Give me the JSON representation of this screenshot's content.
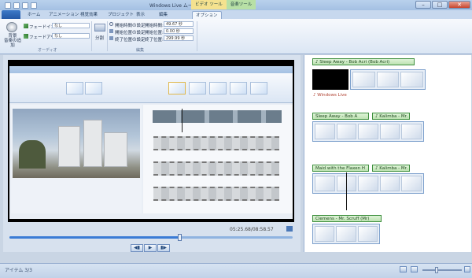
{
  "title": "Windows Live ムービー メーカー",
  "context_groups": [
    {
      "label": "ビデオ ツール",
      "color": "#f5e28f"
    },
    {
      "label": "音楽ツール",
      "color": "#b8e0a6"
    }
  ],
  "tabs": [
    "ホーム",
    "アニメーション",
    "視覚効果",
    "プロジェクト",
    "表示",
    "編集",
    "オプション"
  ],
  "active_tab_index": 6,
  "ribbon": {
    "music_button": "背景\n音楽の追加",
    "fade_in_label": "フェードイン:",
    "fade_in_value": "なし",
    "fade_out_label": "フェードアウト:",
    "fade_out_value": "なし",
    "split_label": "分割",
    "set_start_time": "開始時間の設定",
    "set_start_point": "開始位置の設定",
    "set_end_point": "終了位置の設定",
    "start_time_label": "開始時間:",
    "start_time_value": "49.67 秒",
    "start_point_label": "開始位置:",
    "start_point_value": "0.00 秒",
    "end_point_label": "終了位置:",
    "end_point_value": "299.99 秒",
    "group_audio": "オーディオ",
    "group_edit": "編集"
  },
  "preview": {
    "timecode": "05:25.68/08:58.57"
  },
  "storyboard": {
    "items": [
      {
        "caption": "♪ Sleep Away - Bob Acri (Bob Acri)",
        "dark_first": true,
        "red_caption": "♪ Windows Live"
      },
      {
        "caption": "Sleep Away - Bob A",
        "caption2": "♪ Kalimba - Mr. S"
      },
      {
        "caption": "Maid with the Flaxen H",
        "caption2": "♪ Kalimba - Mr."
      },
      {
        "caption": "Clemens - Mr. Scruff (Mr)"
      }
    ]
  },
  "status": {
    "text": "アイテム 3/3"
  }
}
